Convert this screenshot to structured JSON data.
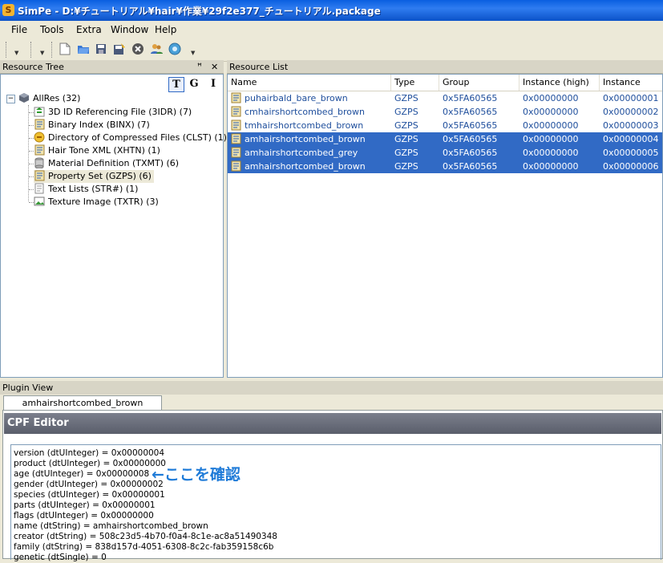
{
  "window": {
    "title": "SimPe - D:¥チュートリアル¥hair¥作業¥29f2e377_チュートリアル.package",
    "app_icon": "S"
  },
  "menu": [
    {
      "label": "File",
      "key": "F"
    },
    {
      "label": "Tools",
      "key": "T"
    },
    {
      "label": "Extra",
      "key": "E"
    },
    {
      "label": "Window",
      "key": "W"
    },
    {
      "label": "Help",
      "key": "H"
    }
  ],
  "toolbar_icons": [
    "new-file-icon",
    "open-folder-icon",
    "save-icon",
    "save-as-icon",
    "close-circle-icon",
    "users-icon",
    "globe-icon"
  ],
  "resource_tree": {
    "header": "Resource Tree",
    "pin_glyph": "📌",
    "close_glyph": "✕",
    "view_buttons": [
      "T",
      "G",
      "I"
    ],
    "root": {
      "label": "AllRes (32)",
      "expander": "−"
    },
    "items": [
      {
        "label": "3D ID Referencing File (3IDR) (7)",
        "icon": "id-ref-icon"
      },
      {
        "label": "Binary Index (BINX) (7)",
        "icon": "binary-index-icon"
      },
      {
        "label": "Directory of Compressed Files (CLST) (1)",
        "icon": "compressed-dir-icon"
      },
      {
        "label": "Hair Tone XML (XHTN) (1)",
        "icon": "xml-icon"
      },
      {
        "label": "Material Definition (TXMT) (6)",
        "icon": "material-icon"
      },
      {
        "label": "Property Set (GZPS) (6)",
        "icon": "property-set-icon"
      },
      {
        "label": "Text Lists (STR#) (1)",
        "icon": "text-list-icon"
      },
      {
        "label": "Texture Image (TXTR) (3)",
        "icon": "texture-icon"
      }
    ]
  },
  "resource_list": {
    "header": "Resource List",
    "columns": [
      "Name",
      "Type",
      "Group",
      "Instance (high)",
      "Instance"
    ],
    "rows": [
      {
        "name": "puhairbald_bare_brown",
        "type": "GZPS",
        "group": "0x5FA60565",
        "inst_high": "0x00000000",
        "instance": "0x00000001",
        "selected": false
      },
      {
        "name": "cmhairshortcombed_brown",
        "type": "GZPS",
        "group": "0x5FA60565",
        "inst_high": "0x00000000",
        "instance": "0x00000002",
        "selected": false
      },
      {
        "name": "tmhairshortcombed_brown",
        "type": "GZPS",
        "group": "0x5FA60565",
        "inst_high": "0x00000000",
        "instance": "0x00000003",
        "selected": false
      },
      {
        "name": "amhairshortcombed_brown",
        "type": "GZPS",
        "group": "0x5FA60565",
        "inst_high": "0x00000000",
        "instance": "0x00000004",
        "selected": true
      },
      {
        "name": "amhairshortcombed_grey",
        "type": "GZPS",
        "group": "0x5FA60565",
        "inst_high": "0x00000000",
        "instance": "0x00000005",
        "selected": true
      },
      {
        "name": "amhairshortcombed_brown",
        "type": "GZPS",
        "group": "0x5FA60565",
        "inst_high": "0x00000000",
        "instance": "0x00000006",
        "selected": true
      }
    ]
  },
  "plugin_view": {
    "header": "Plugin View",
    "tab_label": "amhairshortcombed_brown",
    "editor_title": "CPF Editor",
    "lines": [
      "version (dtUInteger) = 0x00000004",
      "product (dtUInteger) = 0x00000000",
      "age (dtUInteger) = 0x00000008",
      "gender (dtUInteger) = 0x00000002",
      "species (dtUInteger) = 0x00000001",
      "parts (dtUInteger) = 0x00000001",
      "flags (dtUInteger) = 0x00000000",
      "name (dtString) = amhairshortcombed_brown",
      "creator (dtString) = 508c23d5-4b70-f0a4-8c1e-ac8a51490348",
      "family (dtString) = 838d157d-4051-6308-8c2c-fab359158c6b",
      "genetic (dtSingle) = 0"
    ],
    "annotation": "←ここを確認"
  },
  "colors": {
    "selection": "#316ac5",
    "link_text": "#1e4e9c",
    "annotation": "#1f7bd8",
    "titlebar": "#0a5fe0"
  }
}
